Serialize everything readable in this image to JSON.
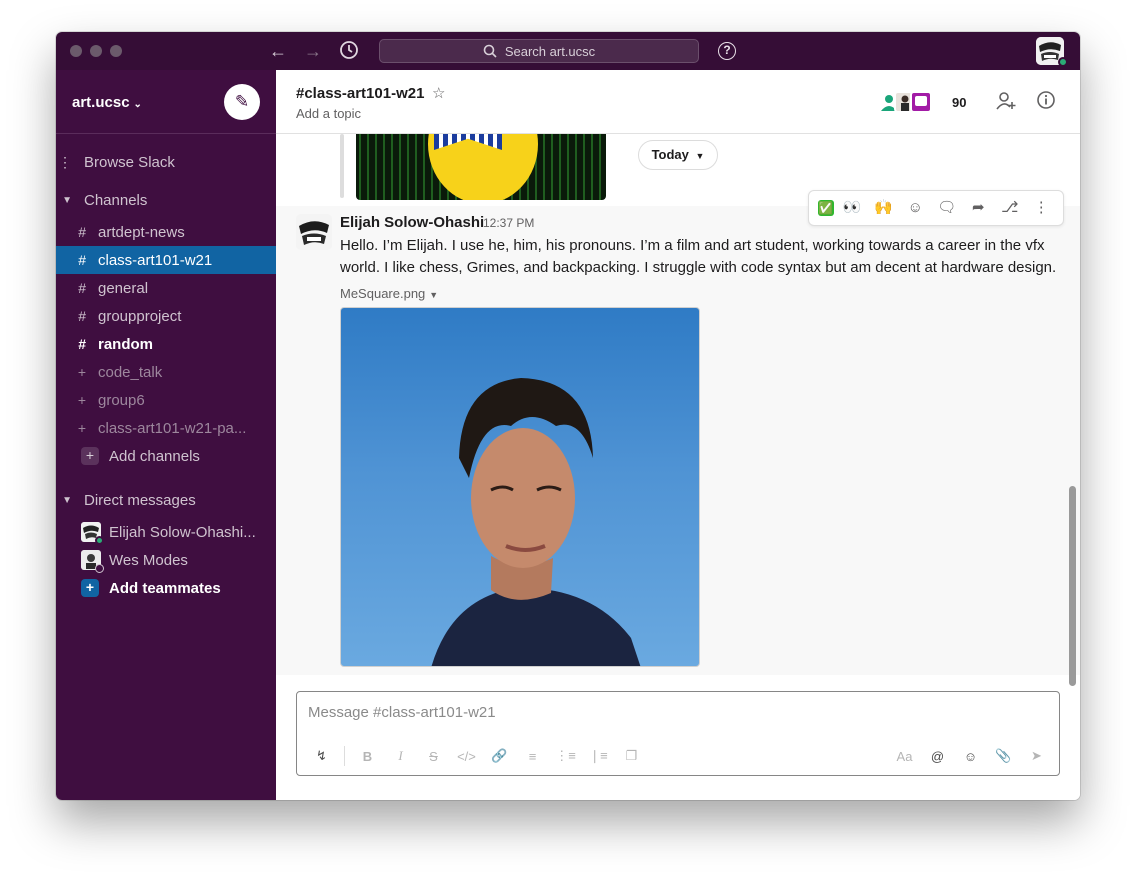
{
  "titlebar": {
    "search_placeholder": "Search art.ucsc",
    "help_label": "?"
  },
  "sidebar": {
    "workspace_name": "art.ucsc",
    "browse": "Browse Slack",
    "channels_heading": "Channels",
    "channels": [
      {
        "name": "artdept-news",
        "prefix": "#",
        "state": "normal"
      },
      {
        "name": "class-art101-w21",
        "prefix": "#",
        "state": "active"
      },
      {
        "name": "general",
        "prefix": "#",
        "state": "normal"
      },
      {
        "name": "groupproject",
        "prefix": "#",
        "state": "normal"
      },
      {
        "name": "random",
        "prefix": "#",
        "state": "bold"
      },
      {
        "name": "code_talk",
        "prefix": "+",
        "state": "muted"
      },
      {
        "name": "group6",
        "prefix": "+",
        "state": "muted"
      },
      {
        "name": "class-art101-w21-pa...",
        "prefix": "+",
        "state": "muted"
      }
    ],
    "add_channels": "Add channels",
    "dm_heading": "Direct messages",
    "direct_messages": [
      {
        "name": "Elijah Solow-Ohashi...",
        "status": "online"
      },
      {
        "name": "Wes Modes",
        "status": "away"
      }
    ],
    "add_teammates": "Add teammates"
  },
  "channel": {
    "name": "#class-art101-w21",
    "topic": "Add a topic",
    "member_count": "90"
  },
  "messages": {
    "date_divider": "Today",
    "author": "Elijah Solow-Ohashi",
    "time": "12:37 PM",
    "text": "Hello. I’m Elijah. I use he, him, his pronouns. I’m a film and art student, working towards a career in the vfx world. I like chess, Grimes, and backpacking. I struggle with code syntax but am decent at hardware design.",
    "file_name": "MeSquare.png"
  },
  "hover_toolbar": {
    "reactions": [
      "✅",
      "👀",
      "🙌"
    ]
  },
  "composer": {
    "placeholder": "Message #class-art101-w21",
    "font_label": "Aa"
  },
  "colors": {
    "aubergine": "#3f0e40",
    "titlebar": "#350d36",
    "active_channel": "#1164a3",
    "online": "#2bac76"
  },
  "icons": [
    "back-arrow-icon",
    "forward-arrow-icon",
    "history-icon",
    "search-icon",
    "help-icon",
    "compose-icon",
    "star-icon",
    "add-member-icon",
    "info-icon",
    "add-reaction-icon",
    "reply-thread-icon",
    "share-icon",
    "bookmark-icon",
    "more-actions-icon",
    "shortcuts-icon",
    "bold-icon",
    "italic-icon",
    "strikethrough-icon",
    "code-icon",
    "link-icon",
    "ordered-list-icon",
    "bullet-list-icon",
    "blockquote-icon",
    "code-block-icon",
    "mention-icon",
    "emoji-icon",
    "attach-icon",
    "send-icon"
  ]
}
